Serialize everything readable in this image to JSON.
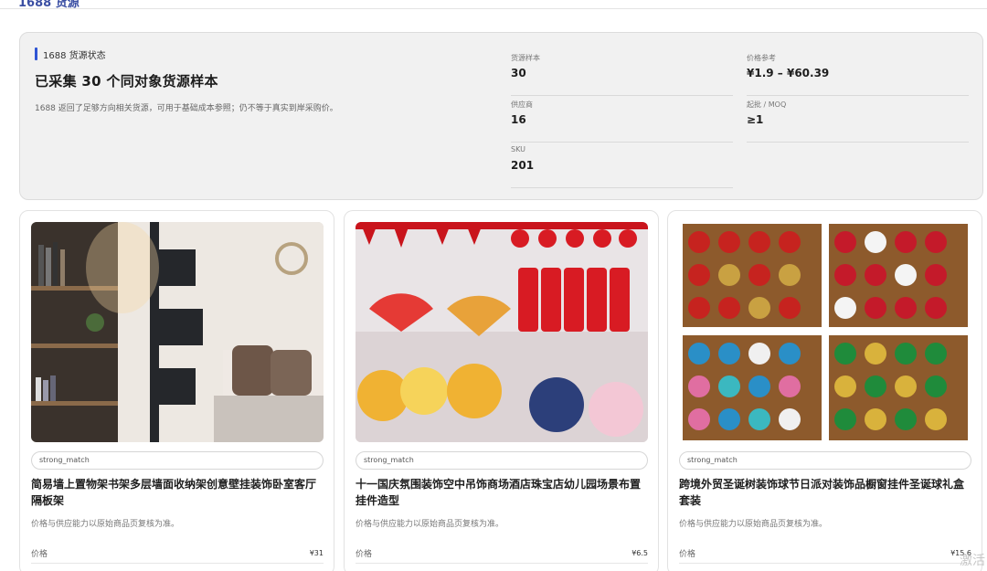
{
  "header": {
    "partial_title": "1688 货源"
  },
  "status": {
    "section_label": "1688 货源状态",
    "title": "已采集 30 个同对象货源样本",
    "description": "1688 返回了足够方向相关货源，可用于基础成本参照；仍不等于真实到岸采购价。",
    "metrics": [
      {
        "label": "货源样本",
        "value": "30"
      },
      {
        "label": "价格参考",
        "value": "¥1.9 – ¥60.39"
      },
      {
        "label": "供应商",
        "value": "16"
      },
      {
        "label": "起批 / MOQ",
        "value": "≥1"
      },
      {
        "label": "SKU",
        "value": "201"
      }
    ]
  },
  "products": [
    {
      "image_icon": "wall-shelf-photo",
      "tag": "strong_match",
      "title": "简易墙上置物架书架多层墙面收纳架创意壁挂装饰卧室客厅隔板架",
      "note": "价格与供应能力以原始商品页复核为准。",
      "price_label": "价格",
      "price": "¥31"
    },
    {
      "image_icon": "festival-hanging-decor-photo",
      "tag": "strong_match",
      "title": "十一国庆氛围装饰空中吊饰商场酒店珠宝店幼儿园场景布置挂件造型",
      "note": "价格与供应能力以原始商品页复核为准。",
      "price_label": "价格",
      "price": "¥6.5"
    },
    {
      "image_icon": "christmas-ornament-balls-photo",
      "tag": "strong_match",
      "title": "跨境外贸圣诞树装饰球节日派对装饰品橱窗挂件圣诞球礼盒套装",
      "note": "价格与供应能力以原始商品页复核为准。",
      "price_label": "价格",
      "price": "¥15.6"
    }
  ],
  "watermark": "激活"
}
